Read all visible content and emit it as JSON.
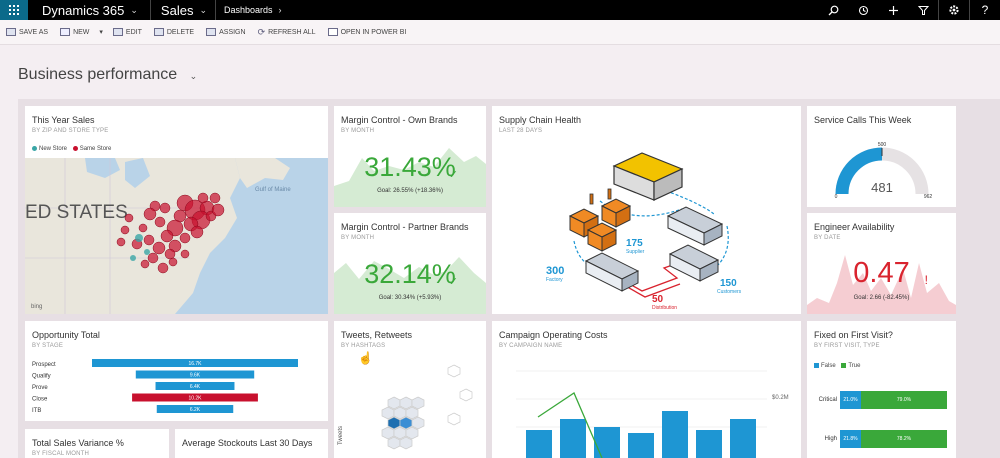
{
  "topbar": {
    "app_name": "Dynamics 365",
    "area": "Sales",
    "breadcrumb": "Dashboards"
  },
  "commands": [
    {
      "label": "SAVE AS",
      "name": "save-as-button"
    },
    {
      "label": "NEW",
      "name": "new-button"
    },
    {
      "label": "EDIT",
      "name": "edit-button"
    },
    {
      "label": "DELETE",
      "name": "delete-button"
    },
    {
      "label": "ASSIGN",
      "name": "assign-button"
    },
    {
      "label": "REFRESH ALL",
      "name": "refresh-all-button"
    },
    {
      "label": "OPEN IN POWER BI",
      "name": "open-in-power-bi-button"
    }
  ],
  "dashboard": {
    "title": "Business performance"
  },
  "tiles": {
    "sales": {
      "title": "This Year Sales",
      "subtitle": "BY ZIP AND STORE TYPE",
      "legend_new": "New Store",
      "legend_same": "Same Store",
      "map_label": "ED STATES",
      "gulf_label": "Gulf of Maine",
      "bing": "bing"
    },
    "margin_own": {
      "title": "Margin Control - Own Brands",
      "subtitle": "BY MONTH",
      "value": "31.43%",
      "goal": "Goal: 26.55% (+18.36%)"
    },
    "margin_partner": {
      "title": "Margin Control - Partner Brands",
      "subtitle": "BY MONTH",
      "value": "32.14%",
      "goal": "Goal: 30.34% (+5.93%)"
    },
    "supply": {
      "title": "Supply Chain Health",
      "subtitle": "LAST 28 DAYS",
      "supplier_value": "175",
      "supplier_label": "Supplier",
      "factory_value": "300",
      "factory_label": "Factory",
      "distribution_value": "50",
      "distribution_label": "Distribution",
      "customers_value": "150",
      "customers_label": "Customers"
    },
    "service": {
      "title": "Service Calls This Week",
      "value": "481",
      "target": "500",
      "min": "0",
      "max": "962",
      "fill": 0.5
    },
    "engineer": {
      "title": "Engineer Availability",
      "subtitle": "BY DATE",
      "value": "0.47",
      "goal": "Goal: 2.66 (-82.45%)"
    },
    "opportunity": {
      "title": "Opportunity Total",
      "subtitle": "BY STAGE",
      "stages": [
        {
          "label": "Prospect",
          "value": "16.7K",
          "amount": 16.7,
          "color": "#1e96d3"
        },
        {
          "label": "Qualify",
          "value": "9.6K",
          "amount": 9.6,
          "color": "#1e96d3"
        },
        {
          "label": "Prove",
          "value": "6.4K",
          "amount": 6.4,
          "color": "#1e96d3"
        },
        {
          "label": "Close",
          "value": "10.2K",
          "amount": 10.2,
          "color": "#c8102e"
        },
        {
          "label": "ITB",
          "value": "6.2K",
          "amount": 6.2,
          "color": "#1e96d3"
        }
      ]
    },
    "tweets": {
      "title": "Tweets, Retweets",
      "subtitle": "BY HASHTAGS",
      "axis_label": "Tweets"
    },
    "campaign": {
      "title": "Campaign Operating Costs",
      "subtitle": "BY CAMPAIGN NAME",
      "axis_right": "$0.2M"
    },
    "fixed": {
      "title": "Fixed on First Visit?",
      "subtitle": "BY FIRST VISIT, TYPE",
      "legend_false": "False",
      "legend_true": "True",
      "rows": [
        {
          "label": "Critical",
          "false": "21.0%",
          "true": "79.0%"
        },
        {
          "label": "High",
          "false": "21.8%",
          "true": "78.2%"
        }
      ]
    },
    "variance": {
      "title": "Total Sales Variance %",
      "subtitle": "BY FISCAL MONTH"
    },
    "stockouts": {
      "title": "Average Stockouts Last 30 Days"
    }
  },
  "colors": {
    "accent_blue": "#1e96d3",
    "kpi_green": "#3aa83a",
    "alert_red": "#d9232e",
    "topbar": "#000000"
  }
}
